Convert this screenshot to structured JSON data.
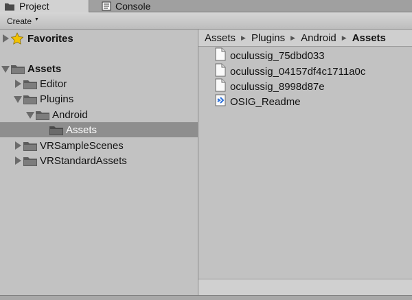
{
  "tabs": [
    {
      "label": "Project",
      "icon": "folder-icon",
      "active": true
    },
    {
      "label": "Console",
      "icon": "console-icon",
      "active": false
    }
  ],
  "toolbar": {
    "create_label": "Create"
  },
  "tree": {
    "favorites": {
      "label": "Favorites",
      "icon": "star-icon"
    },
    "assets": {
      "label": "Assets"
    },
    "editor": {
      "label": "Editor"
    },
    "plugins": {
      "label": "Plugins"
    },
    "android": {
      "label": "Android"
    },
    "android_assets": {
      "label": "Assets",
      "selected": true
    },
    "vr_sample_scenes": {
      "label": "VRSampleScenes"
    },
    "vr_standard_assets": {
      "label": "VRStandardAssets"
    }
  },
  "breadcrumb": [
    "Assets",
    "Plugins",
    "Android",
    "Assets"
  ],
  "files": [
    {
      "name": "oculussig_75dbd033",
      "icon": "document-icon"
    },
    {
      "name": "oculussig_04157df4c1711a0c",
      "icon": "document-icon"
    },
    {
      "name": "oculussig_8998d87e",
      "icon": "document-icon"
    },
    {
      "name": "OSIG_Readme",
      "icon": "visual-studio-icon"
    }
  ],
  "colors": {
    "selection": "#8e8e8e",
    "folder": "#5c5c5c",
    "star": "#f2c200",
    "vs_icon": "#2a6fdb"
  }
}
